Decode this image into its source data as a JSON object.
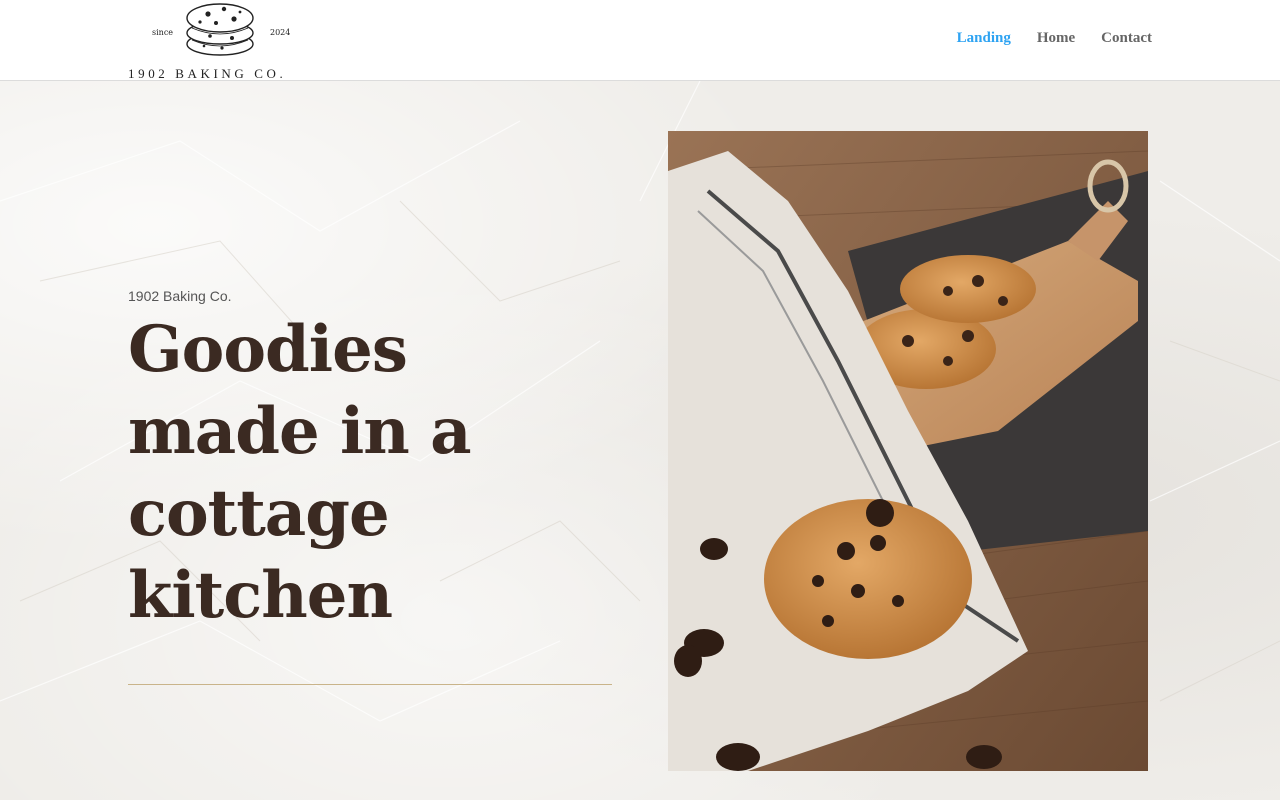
{
  "header": {
    "logo": {
      "since": "since",
      "year": "2024",
      "wordmark": "1902 BAKING CO."
    },
    "nav": [
      {
        "label": "Landing",
        "active": true
      },
      {
        "label": "Home",
        "active": false
      },
      {
        "label": "Contact",
        "active": false
      }
    ]
  },
  "hero": {
    "eyebrow": "1902 Baking Co.",
    "headline_lines": [
      "Goodies",
      "made in a",
      "cottage",
      "kitchen"
    ],
    "photo": {
      "subject": "chocolate chip cookies on a wooden board with a linen towel"
    }
  },
  "colors": {
    "nav_active": "#2ea3f2",
    "nav_default": "#666666",
    "headline": "#3b2a22",
    "divider": "#c9b48a",
    "background": "#efede9"
  }
}
